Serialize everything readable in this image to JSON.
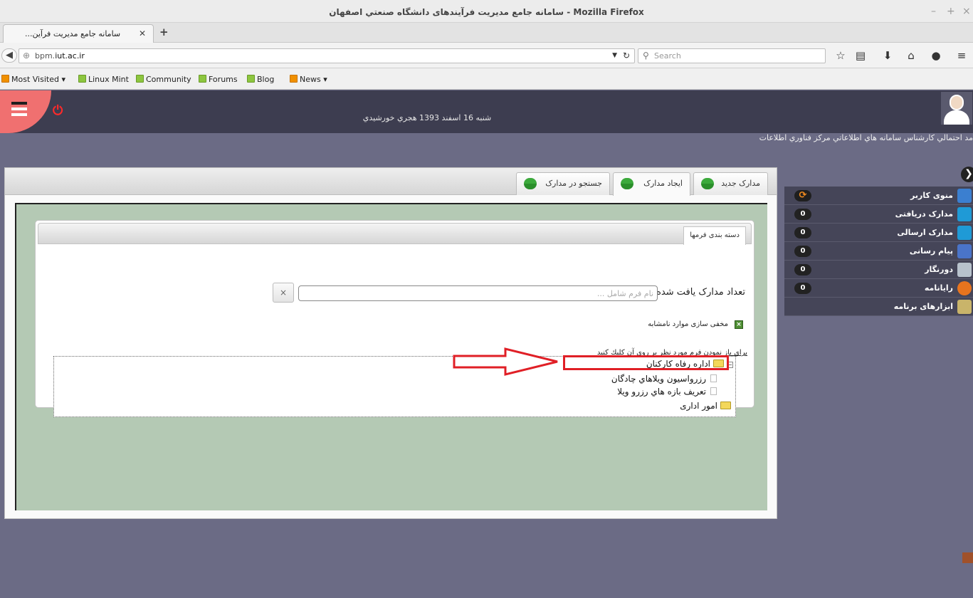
{
  "browser": {
    "window_title": "سامانه جامع مدیریت فرآیندهای دانشگاه صنعتي اصفهان - Mozilla Firefox",
    "tab_title": "...سامانه جامع مدیریت فرآین",
    "url_host": "bpm.",
    "url_domain": "iut.ac.ir",
    "search_placeholder": "Search",
    "window_controls": [
      "–",
      "+",
      "×"
    ],
    "bookmarks": [
      {
        "label": "Most Visited ▾",
        "icon": "rss-icon"
      },
      {
        "label": "Linux Mint",
        "icon": "mint-icon"
      },
      {
        "label": "Community",
        "icon": "mint-icon"
      },
      {
        "label": "Forums",
        "icon": "mint-icon"
      },
      {
        "label": "Blog",
        "icon": "mint-icon"
      },
      {
        "label": "News ▾",
        "icon": "rss-icon"
      }
    ]
  },
  "app": {
    "date": "شنبه 16 اسفند 1393 هجري خورشيدي",
    "user": "مد احتمالي کارشناس سامانه هاي اطلاعاتي مرکز فناوري اطلاعات",
    "tabs": [
      "مدارک جدید",
      "ایجاد مدارک",
      "جستجو در مدارک"
    ],
    "form_tab": "دسته بندی فرمها",
    "count_label": "تعداد مدارک یافت شده:",
    "search_placeholder": "نام فرم شامل ...",
    "clear_label": "×",
    "hide_label": "مخفی سازی موارد نامشابه",
    "hint": "براي باز نمودن فرم مورد نظر بر روي آن کليك کنيد",
    "tree": {
      "root": "اداره رفاه کارکنان",
      "child1": "رزرواسیون ویلاهاي چادگان",
      "child2": "تعریف بازه هاي رزرو ویلا",
      "root2": "امور اداری"
    },
    "side_menu": [
      {
        "label": "منوی کاربر",
        "badge": "⟳",
        "icon": "brush-icon",
        "color": "#3b7fd0"
      },
      {
        "label": "مدارک دریافتی",
        "badge": "0",
        "icon": "inbox-icon",
        "color": "#1f9ad6"
      },
      {
        "label": "مدارک ارسالی",
        "badge": "0",
        "icon": "outbox-icon",
        "color": "#1f9ad6"
      },
      {
        "label": "پیام رسانی",
        "badge": "0",
        "icon": "envelope-icon",
        "color": "#4a74c9"
      },
      {
        "label": "دورنگار",
        "badge": "0",
        "icon": "fax-icon",
        "color": "#b8c2cc"
      },
      {
        "label": "رایانامه",
        "badge": "0",
        "icon": "at-icon",
        "color": "#e8741e"
      },
      {
        "label": "ابزارهای برنامه",
        "badge": "",
        "icon": "tools-icon",
        "color": "#c9b46a"
      }
    ]
  },
  "colors": {
    "page_bg": "#6b6b85",
    "header_bg": "#3d3d50",
    "menu_btn": "#f07070",
    "green_area": "#b4c9b4",
    "highlight_red": "#e01f26"
  }
}
